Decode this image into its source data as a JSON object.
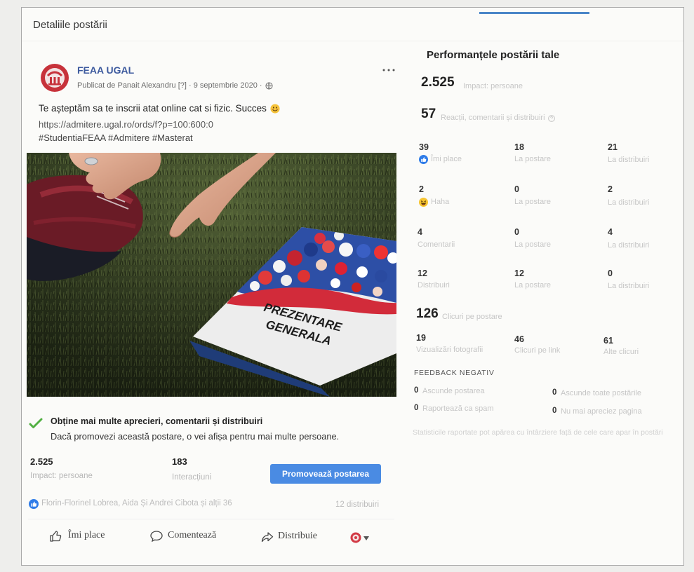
{
  "dialog": {
    "title": "Detaliile postării"
  },
  "post": {
    "page_name": "FEAA UGAL",
    "meta": "Publicat de Panait Alexandru [?] · 9 septembrie 2020 ·",
    "meta_icon": "globe-icon",
    "more_icon": "more-options-icon",
    "text": "Te așteptăm sa te inscrii atat online cat si fizic. Succes",
    "text_emoji": "smiling-face-icon",
    "link": "https://admitere.ugal.ro/ords/f?p=100:600:0",
    "hashtags": "#StudentiaFEAA #Admitere #Masterat",
    "photo_text": {
      "line1": "PREZENTARE",
      "line2": "GENERALA"
    }
  },
  "promotion": {
    "icon": "check-icon",
    "heading": "Obține mai multe aprecieri, comentarii și distribuiri",
    "description": "Dacă promovezi această postare, o vei afișa pentru mai multe persoane.",
    "reach_value": "2.525",
    "reach_label": "Impact: persoane",
    "engagement_value": "183",
    "engagement_label": "Interacțiuni",
    "button_label": "Promovează postarea"
  },
  "reactions": {
    "icon": "like-reaction-icon",
    "summary": "Florin-Florinel Lobrea, Aida Și Andrei Cibota și alții 36",
    "shares": "12 distribuiri"
  },
  "actions": [
    {
      "label": "Îmi place",
      "icon": "thumbs-up-icon"
    },
    {
      "label": "Comentează",
      "icon": "comment-icon"
    },
    {
      "label": "Distribuie",
      "icon": "share-icon"
    }
  ],
  "insights": {
    "title": "Performanțele postării tale",
    "reach": {
      "value": "2.525",
      "label": "Impact: persoane"
    },
    "engagement": {
      "value": "57",
      "label": "Reacții, comentarii și distribuiri"
    },
    "column_on_post": "La postare",
    "column_on_shares": "La distribuiri",
    "breakdown": [
      {
        "total": "39",
        "label": "Îmi place",
        "icon": "like-reaction-icon",
        "on_post": "18",
        "on_shares": "21"
      },
      {
        "total": "2",
        "label": "Haha",
        "icon": "haha-reaction-icon",
        "on_post": "0",
        "on_shares": "2"
      },
      {
        "total": "4",
        "label": "Comentarii",
        "on_post": "0",
        "on_shares": "4"
      },
      {
        "total": "12",
        "label": "Distribuiri",
        "on_post": "12",
        "on_shares": "0"
      }
    ],
    "clicks": {
      "value": "126",
      "label": "Clicuri pe postare"
    },
    "click_breakdown": [
      {
        "value": "19",
        "label": "Vizualizări fotografii"
      },
      {
        "value": "46",
        "label": "Clicuri pe link"
      },
      {
        "value": "61",
        "label": "Alte clicuri"
      }
    ],
    "negative_feedback": {
      "title": "FEEDBACK NEGATIV",
      "items": [
        {
          "value": "0",
          "label": "Ascunde postarea"
        },
        {
          "value": "0",
          "label": "Ascunde toate postările"
        },
        {
          "value": "0",
          "label": "Raportează ca spam"
        },
        {
          "value": "0",
          "label": "Nu mai apreciez pagina"
        }
      ]
    },
    "footnote": "Statisticile raportate pot apărea cu întârziere față de cele care apar în postări"
  },
  "colors": {
    "brand": "#3d5a9e",
    "button": "#4a8be3",
    "like": "#2f7ce8",
    "check": "#52b043",
    "progress": "#4a86c8"
  }
}
